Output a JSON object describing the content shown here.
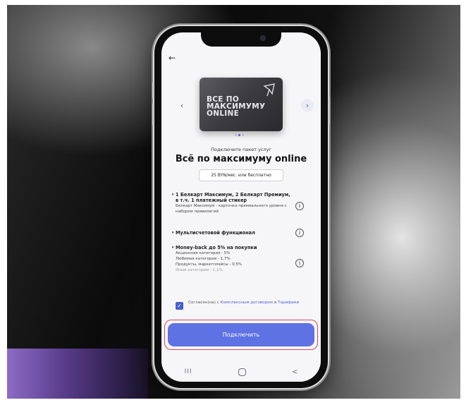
{
  "screen": {
    "back_icon": "arrow-left-icon",
    "carousel": {
      "prev_glyph": "‹",
      "next_glyph": "›",
      "card_lines": [
        "ВСЕ ПО",
        "МАКСИМУМУ",
        "ONLINE"
      ],
      "dots_total": 3,
      "active_dot": 1
    },
    "subtitle": "Подключите пакет услуг",
    "title": "Всё по максимуму online",
    "price": "25 BYN/мес. или бесплатно",
    "features": [
      {
        "title": "1 Белкарт Максимум, 2 Белкарт Премиум, в т.ч. 1 платежный стикер",
        "desc": [
          "Белкарт Максимум - карточка премиального уровня с набором привилегий"
        ],
        "muted": []
      },
      {
        "title": "Мультисчетовой функционал",
        "desc": [],
        "muted": []
      },
      {
        "title": "Money-back до 5% на покупки",
        "desc": [
          "Акционная категория - 5%",
          "Любимая категория - 1,7%",
          "Продукты, маркетплейсы - 0,5%"
        ],
        "muted": [
          "Иные категории - 1,1%"
        ]
      }
    ],
    "agreement": {
      "checked_glyph": "✓",
      "prefix": "Согласен(на) с",
      "link1": "Комплексным договором",
      "and": "и",
      "link2": "Тарифами"
    },
    "cta_label": "Подключить",
    "system_nav": {
      "recent": "III",
      "back": "<"
    }
  },
  "colors": {
    "accent": "#5e72e4",
    "highlight_outline": "#d8455f"
  }
}
